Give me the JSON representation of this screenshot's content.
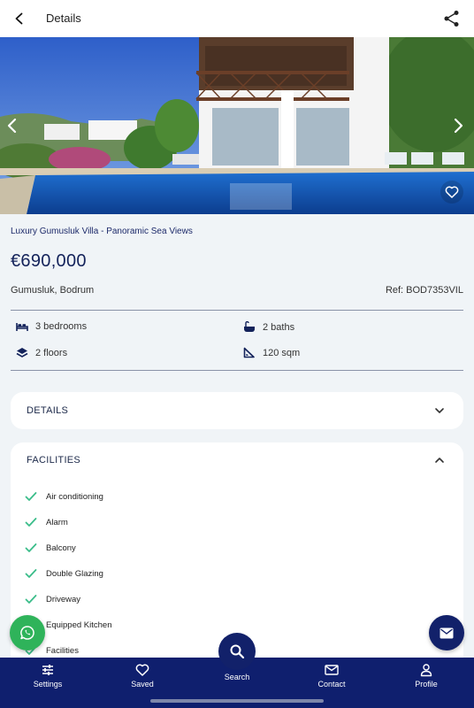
{
  "header": {
    "title": "Details",
    "back_icon": "chevron-left-icon",
    "share_icon": "share-icon"
  },
  "gallery": {
    "prev_icon": "chevron-left-icon",
    "next_icon": "chevron-right-icon",
    "favorite_icon": "heart-outline-icon"
  },
  "listing": {
    "title": "Luxury Gumusluk Villa - Panoramic Sea Views",
    "price": "€690,000",
    "location": "Gumusluk, Bodrum",
    "ref": "Ref: BOD7353VIL"
  },
  "specs": {
    "bedrooms": "3 bedrooms",
    "baths": "2 baths",
    "floors": "2 floors",
    "area": "120 sqm"
  },
  "sections": {
    "details_label": "DETAILS",
    "facilities_label": "FACILITIES"
  },
  "facilities": [
    "Air conditioning",
    "Alarm",
    "Balcony",
    "Double Glazing",
    "Driveway",
    "Equipped Kitchen",
    "Facilities"
  ],
  "nav": {
    "settings": "Settings",
    "saved": "Saved",
    "search": "Search",
    "contact": "Contact",
    "profile": "Profile"
  },
  "colors": {
    "navy": "#0f1f6e",
    "check": "#3bbd8a",
    "whatsapp": "#2fb35a"
  }
}
